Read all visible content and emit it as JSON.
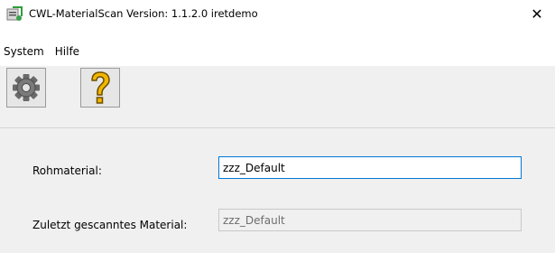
{
  "window": {
    "title": "CWL-MaterialScan  Version: 1.1.2.0  iretdemo",
    "close_glyph": "✕",
    "icon": "app-icon"
  },
  "menu": {
    "items": [
      "System",
      "Hilfe"
    ]
  },
  "toolbar": {
    "buttons": [
      {
        "name": "settings",
        "icon": "gear-icon"
      },
      {
        "name": "help",
        "icon": "question-mark-icon"
      }
    ]
  },
  "form": {
    "rohmaterial_label": "Rohmaterial:",
    "rohmaterial_value": "zzz_Default",
    "last_scanned_label": "Zuletzt gescanntes Material:",
    "last_scanned_value": "zzz_Default"
  },
  "colors": {
    "accent": "#0078d7",
    "panel_bg": "#f0f0f0",
    "help_icon": "#f2b600"
  }
}
